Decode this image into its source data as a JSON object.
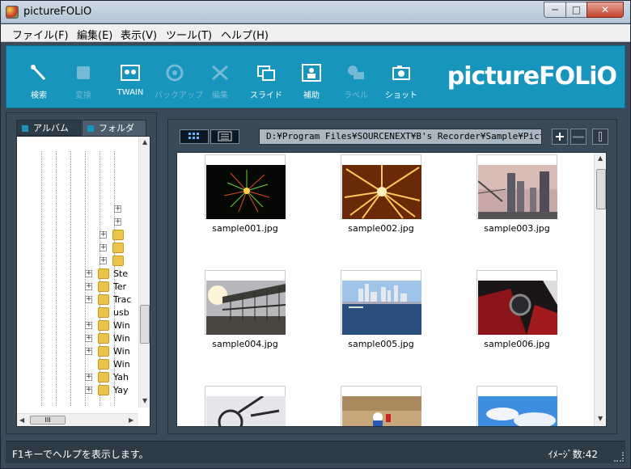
{
  "window": {
    "title": "pictureFOLiO",
    "min_label": "─",
    "max_label": "□",
    "close_label": "✕"
  },
  "menu": [
    "ファイル(F)",
    "編集(E)",
    "表示(V)",
    "ツール(T)",
    "ヘルプ(H)"
  ],
  "toolbar": {
    "brand": "pictureFOLiO",
    "tools": [
      {
        "label": "検索",
        "icon": "wand-icon",
        "enabled": true
      },
      {
        "label": "変換",
        "icon": "convert-icon",
        "enabled": false
      },
      {
        "label": "TWAIN",
        "icon": "twain-icon",
        "enabled": true
      },
      {
        "label": "バックアップ",
        "icon": "backup-icon",
        "enabled": false
      },
      {
        "label": "編集",
        "icon": "edit-icon",
        "enabled": false
      },
      {
        "label": "スライド",
        "icon": "slide-icon",
        "enabled": true
      },
      {
        "label": "補助",
        "icon": "assist-icon",
        "enabled": true
      },
      {
        "label": "ラベル",
        "icon": "label-icon",
        "enabled": false
      },
      {
        "label": "ショット",
        "icon": "shot-icon",
        "enabled": true
      }
    ]
  },
  "left_panel": {
    "tabs": [
      "アルバム",
      "フォルダ"
    ],
    "active_tab": "フォルダ",
    "tree_items": [
      "",
      "",
      "",
      "",
      "",
      "Ste",
      "Ter",
      "Trac",
      "usb",
      "Win",
      "Win",
      "Win",
      "Win",
      "Yah",
      "Yay"
    ],
    "scroll_h_thumb": "III"
  },
  "right_panel": {
    "path": "D:¥Program Files¥SOURCENEXT¥B's Recorder¥Sample¥Picture",
    "plus_label": "+",
    "minus_label": "—",
    "thumbnails": [
      {
        "name": "sample001.jpg",
        "palette": "firework-green"
      },
      {
        "name": "sample002.jpg",
        "palette": "firework-orange"
      },
      {
        "name": "sample003.jpg",
        "palette": "city-dusk"
      },
      {
        "name": "sample004.jpg",
        "palette": "sunset-bridge"
      },
      {
        "name": "sample005.jpg",
        "palette": "harbor-skyline"
      },
      {
        "name": "sample006.jpg",
        "palette": "car-interior"
      },
      {
        "name": "",
        "palette": "bicycle"
      },
      {
        "name": "",
        "palette": "motocross"
      },
      {
        "name": "",
        "palette": "sky-clouds"
      }
    ]
  },
  "status": {
    "text": "F1キーでヘルプを表示します。",
    "count": "ｲﾒｰｼﾞ数:42"
  },
  "colors": {
    "accent": "#1795bd",
    "panel": "#3b4a57",
    "dark": "#2d3b47"
  }
}
